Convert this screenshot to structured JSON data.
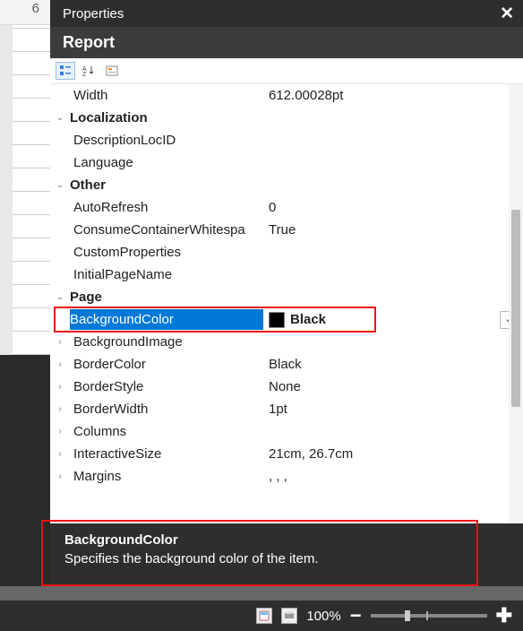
{
  "ruler": {
    "number": "6"
  },
  "panel": {
    "title": "Properties",
    "close_glyph": "✕",
    "object": "Report"
  },
  "toolbar": {
    "categorized_tip": "Categorized",
    "alpha_tip": "Alphabetical",
    "pages_tip": "Property Pages"
  },
  "rows": [
    {
      "type": "prop",
      "indent": 1,
      "name": "Width",
      "value": "612.00028pt"
    },
    {
      "type": "cat",
      "expanded": true,
      "name": "Localization"
    },
    {
      "type": "prop",
      "indent": 1,
      "name": "DescriptionLocID",
      "value": ""
    },
    {
      "type": "prop",
      "indent": 1,
      "name": "Language",
      "value": ""
    },
    {
      "type": "cat",
      "expanded": true,
      "name": "Other"
    },
    {
      "type": "prop",
      "indent": 1,
      "name": "AutoRefresh",
      "value": "0"
    },
    {
      "type": "prop",
      "indent": 1,
      "name": "ConsumeContainerWhitespace",
      "value": "True",
      "truncate": "ConsumeContainerWhitespa"
    },
    {
      "type": "prop",
      "indent": 1,
      "name": "CustomProperties",
      "value": ""
    },
    {
      "type": "prop",
      "indent": 1,
      "name": "InitialPageName",
      "value": ""
    },
    {
      "type": "cat",
      "expanded": true,
      "name": "Page"
    },
    {
      "type": "prop",
      "indent": 1,
      "name": "BackgroundColor",
      "value": "Black",
      "selected": true,
      "swatch": "#000000"
    },
    {
      "type": "prop",
      "indent": 1,
      "expando": true,
      "name": "BackgroundImage",
      "value": ""
    },
    {
      "type": "prop",
      "indent": 1,
      "expando": true,
      "name": "BorderColor",
      "value": "Black"
    },
    {
      "type": "prop",
      "indent": 1,
      "expando": true,
      "name": "BorderStyle",
      "value": "None"
    },
    {
      "type": "prop",
      "indent": 1,
      "expando": true,
      "name": "BorderWidth",
      "value": "1pt"
    },
    {
      "type": "prop",
      "indent": 1,
      "expando": true,
      "name": "Columns",
      "value": ""
    },
    {
      "type": "prop",
      "indent": 1,
      "expando": true,
      "name": "InteractiveSize",
      "value": "21cm, 26.7cm"
    },
    {
      "type": "prop",
      "indent": 1,
      "expando": true,
      "name": "Margins",
      "value": ", , ,"
    }
  ],
  "description": {
    "title": "BackgroundColor",
    "text": "Specifies the background color of the item."
  },
  "zoom": {
    "label": "100%"
  }
}
